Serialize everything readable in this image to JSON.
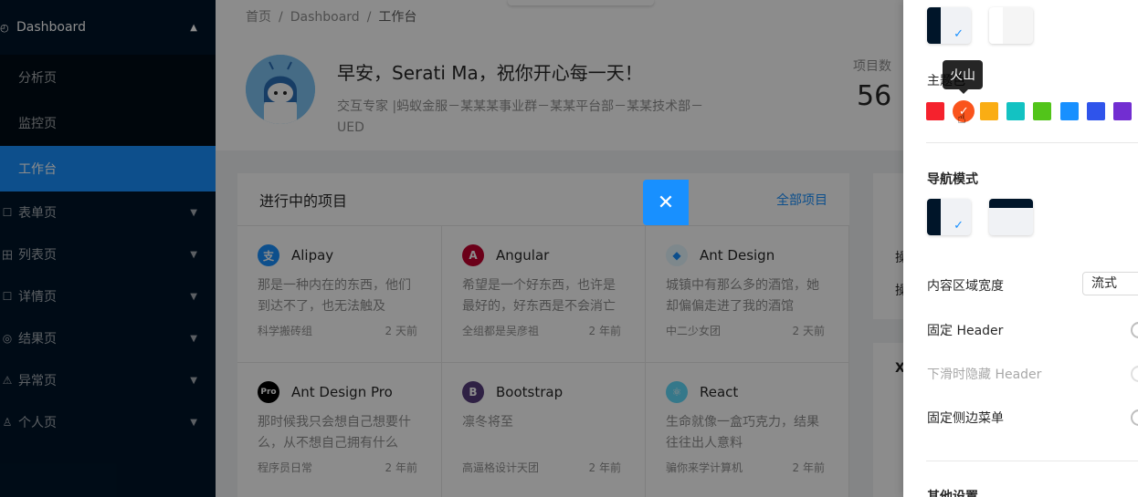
{
  "sidebar": {
    "dashboard_label": "Dashboard",
    "sub_items": [
      {
        "label": "分析页"
      },
      {
        "label": "监控页"
      },
      {
        "label": "工作台"
      }
    ],
    "items": [
      {
        "label": "表单页"
      },
      {
        "label": "列表页"
      },
      {
        "label": "详情页"
      },
      {
        "label": "结果页"
      },
      {
        "label": "异常页"
      },
      {
        "label": "个人页"
      }
    ]
  },
  "breadcrumb": {
    "home": "首页",
    "dashboard": "Dashboard",
    "current": "工作台"
  },
  "header": {
    "greeting": "早安，Serati Ma，祝你开心每一天！",
    "role": "交互专家 |蚂蚁金服－某某某事业群－某某平台部－某某技术部－UED",
    "stat_label": "项目数",
    "stat_value": "56"
  },
  "projects": {
    "title": "进行中的项目",
    "all_link": "全部项目",
    "items": [
      {
        "name": "Alipay",
        "desc": "那是一种内在的东西，他们到达不了，也无法触及",
        "group": "科学搬砖组",
        "time": "2 天前",
        "icon": "alipay-icon",
        "color": "#1890ff",
        "glyph": "支"
      },
      {
        "name": "Angular",
        "desc": "希望是一个好东西，也许是最好的，好东西是不会消亡的",
        "group": "全组都是吴彦祖",
        "time": "2 年前",
        "icon": "angular-icon",
        "color": "#c3002f",
        "glyph": "A"
      },
      {
        "name": "Ant Design",
        "desc": "城镇中有那么多的酒馆，她却偏偏走进了我的酒馆",
        "group": "中二少女团",
        "time": "2 天前",
        "icon": "ant-design-icon",
        "color": "#e6f7ff",
        "glyph": "◆"
      },
      {
        "name": "Ant Design Pro",
        "desc": "那时候我只会想自己想要什么，从不想自己拥有什么",
        "group": "程序员日常",
        "time": "2 年前",
        "icon": "ant-design-pro-icon",
        "color": "#000000",
        "glyph": "Pro"
      },
      {
        "name": "Bootstrap",
        "desc": "凛冬将至",
        "group": "高逼格设计天团",
        "time": "2 年前",
        "icon": "bootstrap-icon",
        "color": "#563d7c",
        "glyph": "B"
      },
      {
        "name": "React",
        "desc": "生命就像一盒巧克力，结果往往出人意料",
        "group": "骗你来学计算机",
        "time": "2 年前",
        "icon": "react-icon",
        "color": "#61dafb",
        "glyph": "⚛"
      }
    ]
  },
  "right_panel": {
    "text1": "操",
    "text2": "操",
    "text3": "X"
  },
  "drawer": {
    "theme_color_label": "主题色",
    "tooltip": "火山",
    "colors": [
      "#f5222d",
      "#fa541c",
      "#faad14",
      "#13c2c2",
      "#52c41a",
      "#1890ff",
      "#2f54eb",
      "#722ed1"
    ],
    "nav_mode_label": "导航模式",
    "content_width_label": "内容区域宽度",
    "content_width_value": "流式",
    "fixed_header_label": "固定 Header",
    "hide_header_label": "下滑时隐藏 Header",
    "fixed_sidebar_label": "固定侧边菜单",
    "other_settings_label": "其他设置"
  }
}
